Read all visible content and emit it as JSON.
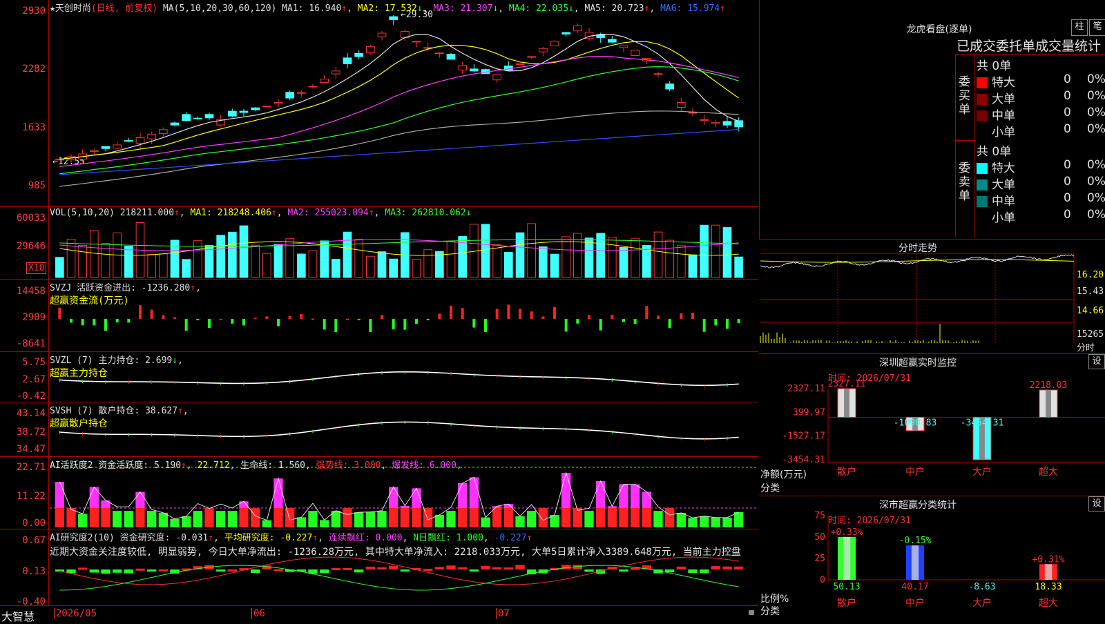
{
  "app": {
    "brand": "大智慧"
  },
  "price_pane": {
    "header": {
      "star": "★",
      "name": "天创时尚",
      "mode": "(日线, 前复权)",
      "ma_def": "MA(5,10,20,30,60,120)",
      "ma1": "MA1: 16.940",
      "ma2": "MA2: 17.532",
      "ma3": "MA3: 21.307",
      "ma4": "MA4: 22.035",
      "ma5": "MA5: 20.723",
      "ma6": "MA6: 15.974"
    },
    "yticks": [
      "2930",
      "2282",
      "1633",
      "985"
    ],
    "high_label": "29.30",
    "low_label": "12.55"
  },
  "vol_pane": {
    "header": {
      "def": "VOL(5,10,20)",
      "v": "218211.000",
      "ma1": "MA1: 218248.406",
      "ma2": "MA2: 255023.094",
      "ma3": "MA3: 262810.062"
    },
    "yticks": [
      "60033",
      "29646"
    ],
    "unit": "X10"
  },
  "svzj_pane": {
    "header": {
      "def": "SVZJ",
      "desc": "活跃资金进出: -1236.280",
      "sub": "超赢资金流(万元)"
    },
    "yticks": [
      "14458",
      "2909",
      "-8641"
    ]
  },
  "svzl_pane": {
    "header": {
      "def": "SVZL (7)",
      "desc": "主力持仓: 2.699",
      "sub": "超赢主力持仓"
    },
    "yticks": [
      "5.75",
      "2.67",
      "-0.42"
    ]
  },
  "svsh_pane": {
    "header": {
      "def": "SVSH (7)",
      "desc": "散户持仓: 38.627",
      "sub": "超赢散户持仓"
    },
    "yticks": [
      "43.14",
      "38.72",
      "34.47"
    ]
  },
  "ai_pane": {
    "header": {
      "def": "AI活跃度2 资金活跃度: 5.190",
      "v2": "22.712",
      "life": "生命线: 1.560",
      "strong": "强势线: 3.000",
      "burst": "爆发线: 6.000"
    },
    "yticks": [
      "22.71",
      "11.22",
      "0.00"
    ]
  },
  "research_pane": {
    "header": {
      "def": "AI研究度2(10) 资金研究度: -0.031",
      "avg": "平均研究度: -0.227",
      "cont": "连续飘红: 0.000",
      "nday": "N日飘红: 1.000",
      "last": "-0.227"
    },
    "comment": "近期大资金关注度较低, 明显弱势, 今日大单净流出: -1236.28万元, 其中特大单净流入: 2218.033万元, 大单5日累计净入3389.648万元, 当前主力控盘",
    "yticks": [
      "0.67",
      "0.13",
      "-0.40"
    ]
  },
  "xaxis": {
    "labels": [
      "2026/05",
      "06",
      "07"
    ]
  },
  "right": {
    "lhb": {
      "title": "龙虎看盘(逐单)",
      "btn1": "柱",
      "btn2": "笔",
      "subtitle": "已成交委托单成交量统计",
      "buy": {
        "side": "委买单",
        "total": "共 0单",
        "rows": [
          {
            "name": "特大",
            "val": "0",
            "pct": "0%",
            "color": "#ff0000"
          },
          {
            "name": "大单",
            "val": "0",
            "pct": "0%",
            "color": "#8b0000"
          },
          {
            "name": "中单",
            "val": "0",
            "pct": "0%",
            "color": "#7a0000"
          },
          {
            "name": "小单",
            "val": "0",
            "pct": "0%",
            "color": "#000000"
          }
        ]
      },
      "sell": {
        "side": "委卖单",
        "total": "共 0单",
        "rows": [
          {
            "name": "特大",
            "val": "0",
            "pct": "0%",
            "color": "#00ffff"
          },
          {
            "name": "大单",
            "val": "0",
            "pct": "0%",
            "color": "#008b8b"
          },
          {
            "name": "中单",
            "val": "0",
            "pct": "0%",
            "color": "#007777"
          },
          {
            "name": "小单",
            "val": "0",
            "pct": "0%",
            "color": "#000000"
          }
        ]
      }
    },
    "fenshi": {
      "title": "分时走势",
      "yticks": [
        "16.20",
        "15.43",
        "14.66",
        "15265"
      ],
      "unit": "分时"
    },
    "monitor": {
      "title": "深圳超赢实时监控",
      "btn": "设",
      "time": "时间: 2026/07/31",
      "yticks": [
        "2327.11",
        "399.97",
        "-1527.17",
        "-3454.31"
      ],
      "ylabel": "净额(万元)",
      "xlabel": "分类",
      "bars": [
        {
          "cat": "散户",
          "value": 2327.11,
          "label": "2327.11",
          "color": "#e0e0e0"
        },
        {
          "cat": "中户",
          "value": -1090.83,
          "label": "-1090.83",
          "color": "#e0e0e0"
        },
        {
          "cat": "大户",
          "value": -3454.31,
          "label": "-3454.31",
          "color": "#40ffff"
        },
        {
          "cat": "超大",
          "value": 2218.03,
          "label": "2218.03",
          "color": "#e0e0e0"
        }
      ]
    },
    "stats": {
      "title": "深市超赢分类统计",
      "btn": "设",
      "time": "时间: 2026/07/31",
      "yticks": [
        "75",
        "50",
        "25",
        "0"
      ],
      "ylabel": "比例%",
      "xlabel": "分类",
      "bars": [
        {
          "cat": "散户",
          "value": 50.13,
          "label": "50.13",
          "pct": "+0.33%",
          "color": "#30ff30"
        },
        {
          "cat": "中户",
          "value": 40.17,
          "label": "40.17",
          "pct": "-0.15%",
          "color": "#2040ff"
        },
        {
          "cat": "大户",
          "value": -8.63,
          "label": "-8.63",
          "pct": "",
          "color": "#40ffff"
        },
        {
          "cat": "超大",
          "value": 18.33,
          "label": "18.33",
          "pct": "+0.31%",
          "color": "#ff2020"
        }
      ]
    }
  }
}
